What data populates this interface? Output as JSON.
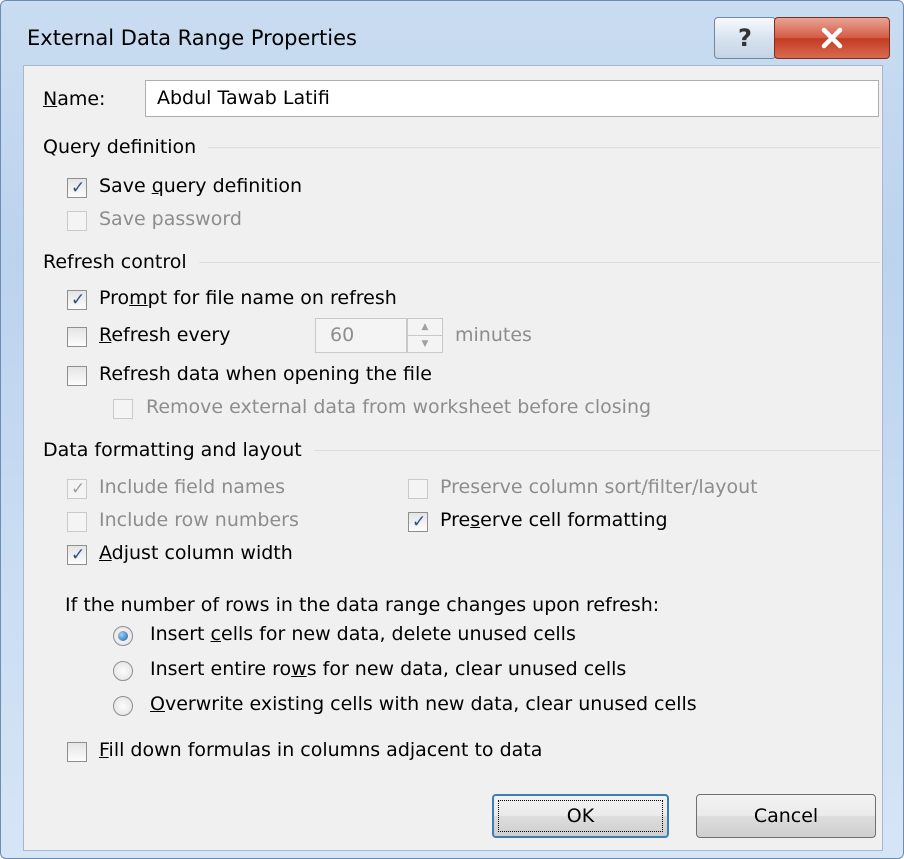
{
  "window": {
    "title": "External Data Range Properties",
    "help_glyph": "?",
    "close_glyph": "✕"
  },
  "name": {
    "label_hotkey": "N",
    "label_rest": "ame:",
    "value": "Abdul Tawab Latifi"
  },
  "query_definition": {
    "title": "Query definition",
    "save_query": {
      "pre": "Save ",
      "hotkey": "q",
      "post": "uery definition",
      "checked": true
    },
    "save_password": {
      "label": "Save password",
      "checked": false,
      "disabled": true
    }
  },
  "refresh_control": {
    "title": "Refresh control",
    "prompt": {
      "pre": "Pro",
      "hotkey": "m",
      "post": "pt for file name on refresh",
      "checked": true
    },
    "refresh_every": {
      "pre": "",
      "hotkey": "R",
      "post": "efresh every",
      "value": "60",
      "unit": "minutes",
      "checked": false
    },
    "refresh_on_open": {
      "pre": "Refresh data when opening the f",
      "hotkey": "i",
      "post": "le",
      "checked": false
    },
    "remove_external": {
      "label": "Remove external data from worksheet before closing",
      "checked": false,
      "disabled": true
    }
  },
  "data_formatting": {
    "title": "Data formatting and layout",
    "include_field_names": {
      "label": "Include field names",
      "checked": true,
      "disabled": true
    },
    "preserve_sort": {
      "label": "Preserve column sort/filter/layout",
      "checked": false,
      "disabled": true
    },
    "include_row_numbers": {
      "label": "Include row numbers",
      "checked": false,
      "disabled": true
    },
    "preserve_cell": {
      "pre": "Pre",
      "hotkey": "s",
      "post": "erve cell formatting",
      "checked": true
    },
    "adjust_width": {
      "pre": "",
      "hotkey": "A",
      "post": "djust column width",
      "checked": true
    }
  },
  "rows_change": {
    "prompt": "If the number of rows in the data range changes upon refresh:",
    "options": [
      {
        "pre": "Insert ",
        "hotkey": "c",
        "post": "ells for new data, delete unused cells",
        "selected": true
      },
      {
        "pre": "Insert entire ro",
        "hotkey": "w",
        "post": "s for new data, clear unused cells",
        "selected": false
      },
      {
        "pre": "",
        "hotkey": "O",
        "post": "verwrite existing cells with new data, clear unused cells",
        "selected": false
      }
    ]
  },
  "fill_down": {
    "pre": "",
    "hotkey": "F",
    "post": "ill down formulas in columns adjacent to data",
    "checked": false
  },
  "buttons": {
    "ok": "OK",
    "cancel": "Cancel"
  }
}
